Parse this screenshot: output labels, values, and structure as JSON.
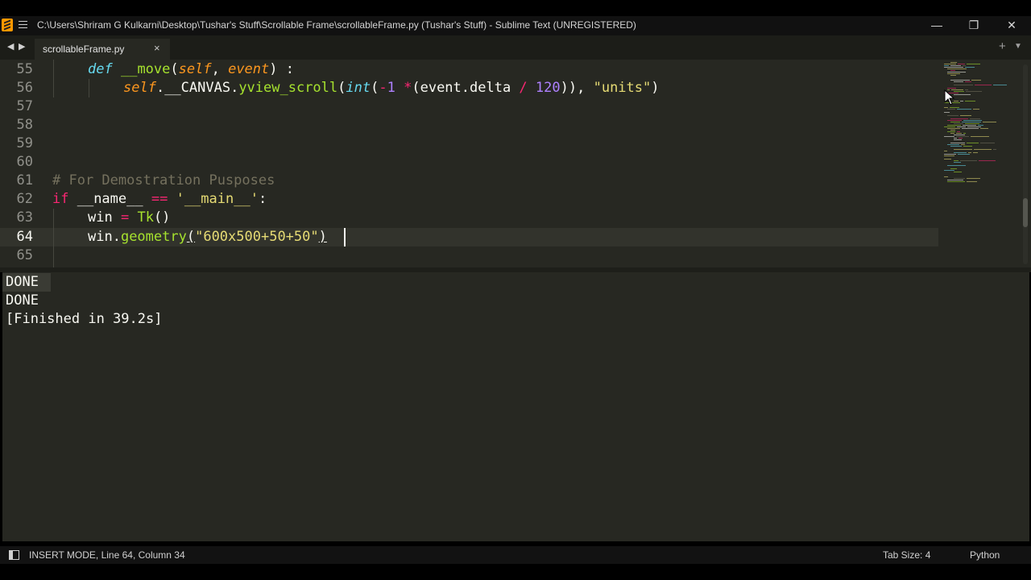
{
  "window": {
    "title": "C:\\Users\\Shriram G Kulkarni\\Desktop\\Tushar's Stuff\\Scrollable Frame\\scrollableFrame.py (Tushar's Stuff) - Sublime Text (UNREGISTERED)",
    "minimize": "—",
    "restore": "❐",
    "close": "✕"
  },
  "tabs": {
    "back": "◀",
    "forward": "▶",
    "active_tab": "scrollableFrame.py",
    "close": "×",
    "new_tab": "+",
    "menu": "▼"
  },
  "editor": {
    "line_numbers": [
      "55",
      "56",
      "57",
      "58",
      "59",
      "60",
      "61",
      "62",
      "63",
      "64",
      "65"
    ],
    "active_line": "64",
    "lines": {
      "l55": {
        "kw": "def",
        "fn": "__move",
        "open": "(",
        "p1": "self",
        "comma": ", ",
        "p2": "event",
        "close": ") :"
      },
      "l56": {
        "self": "self",
        "mid": ".__CANVAS.",
        "fn": "yview_scroll",
        "open": "(",
        "int": "int",
        "p": "(",
        "minus": "-",
        "one": "1",
        "sp": " ",
        "star": "*",
        "expr": "(event.delta ",
        "slash": "/",
        "sp2": " ",
        "num": "120",
        "close": ")), ",
        "str": "\"units\"",
        "end": ")"
      },
      "l61": {
        "comment": "# For Demostration Pusposes"
      },
      "l62": {
        "kw": "if",
        "a": " __name__ ",
        "op": "==",
        "sp": " ",
        "str": "'__main__'",
        "end": ":"
      },
      "l63": {
        "a": "win ",
        "op": "=",
        "sp": " ",
        "fn": "Tk",
        "end": "()"
      },
      "l64": {
        "a": "win.",
        "fn": "geometry",
        "open": "(",
        "str": "\"600x500+50+50\"",
        "end": ")"
      }
    }
  },
  "output": {
    "lines": [
      "DONE",
      "DONE",
      "[Finished in 39.2s]"
    ]
  },
  "status": {
    "text": "INSERT MODE, Line 64, Column 34",
    "tab_size": "Tab Size: 4",
    "syntax": "Python"
  },
  "colors": {
    "background": "#272822",
    "keyword": "#f92672",
    "function": "#a6e22e",
    "string": "#e6db74",
    "number": "#ae81ff",
    "parameter": "#fd971f",
    "builtin": "#66d9ef",
    "comment": "#75715e"
  }
}
